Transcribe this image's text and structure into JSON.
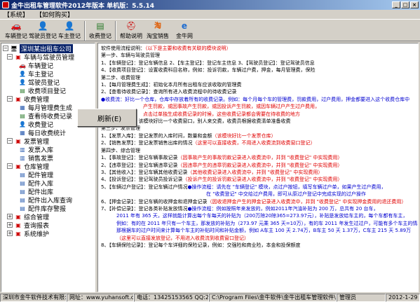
{
  "window": {
    "title": "金牛出租车管理软件2012年版本  单机版：5.5.14"
  },
  "menu": [
    "【系统】",
    "【如何购买】"
  ],
  "toolbar": [
    {
      "label": "车辆登记",
      "icon": "car-icon"
    },
    {
      "label": "驾驶员登记",
      "icon": "driver-icon"
    },
    {
      "label": "车主登记",
      "icon": "owner-icon"
    },
    {
      "label": "收费登记",
      "icon": "fee-icon"
    },
    {
      "label": "帮助说明",
      "icon": "help-icon"
    },
    {
      "label": "淘宝销售",
      "icon": "taobao-icon"
    },
    {
      "label": "金牛网",
      "icon": "ie-icon"
    }
  ],
  "tree": {
    "root": "深圳某出租车公司",
    "groups": [
      {
        "label": "车辆与驾驶员管理",
        "items": [
          "车辆登记",
          "车主登记",
          "驾驶员登记",
          "收费项目登记"
        ]
      },
      {
        "label": "收费管理",
        "items": [
          "每月管理费生成",
          "查看待收费记录",
          "收费登记",
          "每日收费统计"
        ]
      },
      {
        "label": "发票管理",
        "items": [
          "发票入库",
          "销售发票"
        ]
      },
      {
        "label": "仓库管理",
        "items": [
          "配件管理",
          "配件入库",
          "配件出库",
          "配件出入库查询",
          "配件库存警报"
        ]
      }
    ],
    "others": [
      "综合管理",
      "查询报表",
      "系统维护"
    ]
  },
  "context_menu": {
    "refresh": "刷新(E)"
  },
  "content": {
    "l1": "软件使用流程说明：",
    "l1r": "（以下是主要和收费有关联的模块说明）",
    "l2": "第一步、车辆与驾驶员管理",
    "l3": "1、【车辆登记】：登记车辆信息      2、【车主登记】：登记车主信息      3、【驾驶员登记】：登记驾驶员信息",
    "l4": "4、【收费项目登记】：设置收费科目名称，例如：投诉罚款，车辆过户费，押金，每月管理费，保险",
    "l5": "第二步、收费管理",
    "l6": "1、【每月管理费生成】：初始化本月所有出租车应该收取的管理费",
    "l7": "2、【查看待收费记录】：查询所有进入收费流程中的待收费记录",
    "l8": "●收费流：好比一个仓库，仓库中存放着所有的收费记录。例如：每个月每个车的管理费，罚款费用，过户费用，押金都要进入这个收费仓库中",
    "l9": "产生罚款，或因事故产生罚款，或因投诉产生罚款，或因车辆过户产生过户费用，",
    "l10": "点击过单独生成收费记录的时候，这些收费记录都会需要在待收费的地方",
    "l11": "3、【收费登记】：该模块好比一个收费窗口，别人来交费，收费员根据收费清单准备收费",
    "l12": "第三步、发票管理",
    "l13": "1、【发票入库】：登记发票的入库时间，数量和金额",
    "l13r": "（该模块好比一个发票仓库）",
    "l14": "2、【销售发票】：登记发票销售出库的情况",
    "l14r": "（这里可以直接收费，不用进入收费流到收费窗口登记）",
    "l15": "第四步、综合管理",
    "l16": "1、【事故登记】：登记车辆事故记录",
    "l16r": "（因事故产生的事故罚款记录进入收费流中，并到 \"收费登记\" 中实现费用）",
    "l17": "2、【违章登记】：登记车辆违章记录",
    "l17r": "（因违章产生的违章罚款记录进入收费流中，并到 \"收费登记\" 中实现费用）",
    "l18": "3、【其他收入】：登记车辆其他收费记录",
    "l18r": "（其他收费记录进入收费流中，并到 \"收费登记\" 中实现费用）",
    "l19": "4、【投诉登记】：登记驾驶员投诉记录",
    "l19r": "（投诉产生的投诉罚款记录进入收费流中，并到 \"收费登记\" 中实现费用）",
    "l20": "5、【车辆过户登记】：登记车辆过户情况",
    "l20r": "●操作流程：请先在 \"车辆登记\" 模块，点过户按钮，填写车辆过户单，如果产生过户费用，",
    "l21": "在 \"收费登记\" 中交给过户费用，即可从原过户登记中完成实现的过户操作",
    "l22": "6、【押金记录】：登记车辆的收押金和退押金记录",
    "l22r": "（因收退押金产生的押金记录进入收费流中，并到 \"收费登记\" 中实现押金费用的退还费用）",
    "l23": "7、【补偿记录】：登记各类补贴发放情况",
    "l23r": "●操作流程：例如按照年来发放的，例如2011年汽油补贴为 200 万，总共有 20 台车，",
    "l24": "2011 年有 365 天，这样就能计算出每个车每天的补贴为（200万除20除365=273.97元），补贴是发放给车主的，每个车都有车主，",
    "l25": "例如：有的在 2011 年只有一个车主，那发放的补贴为（273.97 元乘 365 天=10万），有的车 2011 年发生过过户，可能有多个车主的情况，",
    "l26": "那根据车的过户时间来计算每个车主的补贴时间和补贴金额，例如 A车主 100 天 2.74万，B车主 50 天 1.37万，C车主 215 天 5.89万",
    "l27": "（这里可以直接发放登记，不用进入收费流到收费窗口登记）",
    "l28": "8、【车辆保险记录】：登记每个车详细的保险记录，例如：交强险和商业险，本金和投保额度"
  },
  "status": {
    "company": "深圳市金牛软件技术有限公司",
    "website": "网址：www.yuhansoft.com",
    "phone": "电话：13425153565 QQ:21035391",
    "path": "C:\\Program Files\\金牛软件\\金牛出租车管理软件\\案例",
    "user": "管理员",
    "date": "2012-1-29"
  }
}
